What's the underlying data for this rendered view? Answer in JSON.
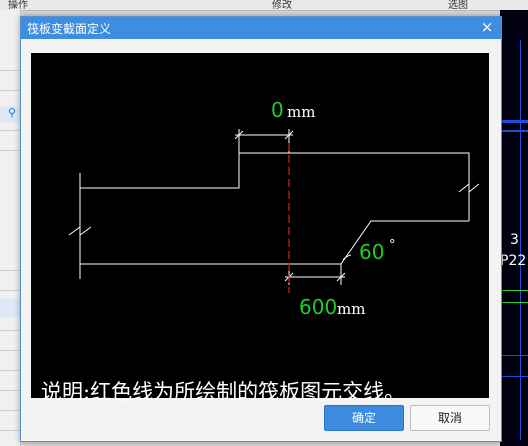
{
  "background": {
    "topbar_left": "操作",
    "topbar_mid": "修改",
    "topbar_right": "选图",
    "right_panel": {
      "label_3": "3",
      "label_p22": "P22"
    }
  },
  "dialog": {
    "title": "筏板变截面定义",
    "close_glyph": "×",
    "ok_label": "确定",
    "cancel_label": "取消"
  },
  "diagram": {
    "top_offset_value": "0",
    "top_offset_unit": "mm",
    "width_value": "600",
    "width_unit": "mm",
    "angle_value": "60",
    "angle_unit": "°",
    "caption": "说明:红色线为所绘制的筏板图元交线。"
  },
  "colors": {
    "title_bar": "#3d8ee0",
    "value_green": "#22cc22",
    "cut_line_red": "#cc2222"
  }
}
